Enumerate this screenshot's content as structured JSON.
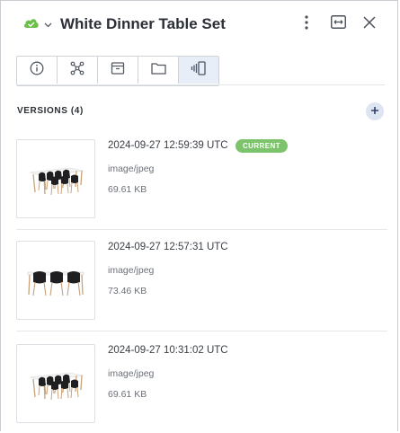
{
  "header": {
    "title": "White Dinner Table Set",
    "icons": [
      "cloud-icon",
      "chevron-down-icon",
      "more-vertical-icon",
      "expand-horizontal-icon",
      "close-icon"
    ]
  },
  "tabs": [
    {
      "name": "info",
      "icon": "info-icon",
      "active": false
    },
    {
      "name": "relations",
      "icon": "nodes-icon",
      "active": false
    },
    {
      "name": "archive",
      "icon": "box-icon",
      "active": false
    },
    {
      "name": "folder",
      "icon": "folder-icon",
      "active": false
    },
    {
      "name": "versions",
      "icon": "versions-icon",
      "active": true
    }
  ],
  "versions_section": {
    "title": "VERSIONS (4)",
    "add_icon": "plus-icon"
  },
  "versions": [
    {
      "date": "2024-09-27 12:59:39 UTC",
      "type": "image/jpeg",
      "size": "69.61 KB",
      "badge": "CURRENT"
    },
    {
      "date": "2024-09-27 12:57:31 UTC",
      "type": "image/jpeg",
      "size": "73.46 KB",
      "badge": ""
    },
    {
      "date": "2024-09-27 10:31:02 UTC",
      "type": "image/jpeg",
      "size": "69.61 KB",
      "badge": ""
    }
  ],
  "colors": {
    "accent_cloud": "#6cc04a",
    "badge_green": "#7cc36b",
    "active_tab_bg": "#e8eef8",
    "add_button_bg": "#dde5f3"
  }
}
